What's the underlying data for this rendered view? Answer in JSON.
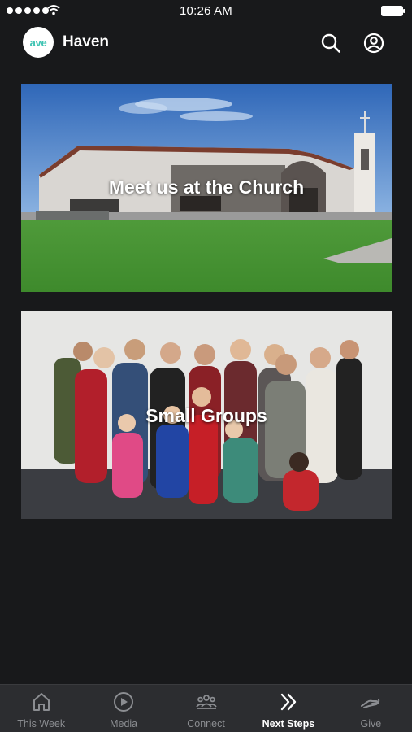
{
  "status_bar": {
    "time": "10:26 AM"
  },
  "header": {
    "logo_text": "ave",
    "title": "Haven",
    "accent_color": "#3cc3b2"
  },
  "cards": [
    {
      "label": "Meet us at the Church"
    },
    {
      "label": "Small Groups"
    }
  ],
  "tab_bar": {
    "tabs": [
      {
        "label": "This Week",
        "icon": "home-icon",
        "active": false
      },
      {
        "label": "Media",
        "icon": "play-circle-icon",
        "active": false
      },
      {
        "label": "Connect",
        "icon": "people-icon",
        "active": false
      },
      {
        "label": "Next Steps",
        "icon": "double-chevron-right-icon",
        "active": true
      },
      {
        "label": "Give",
        "icon": "giving-hand-icon",
        "active": false
      }
    ]
  }
}
